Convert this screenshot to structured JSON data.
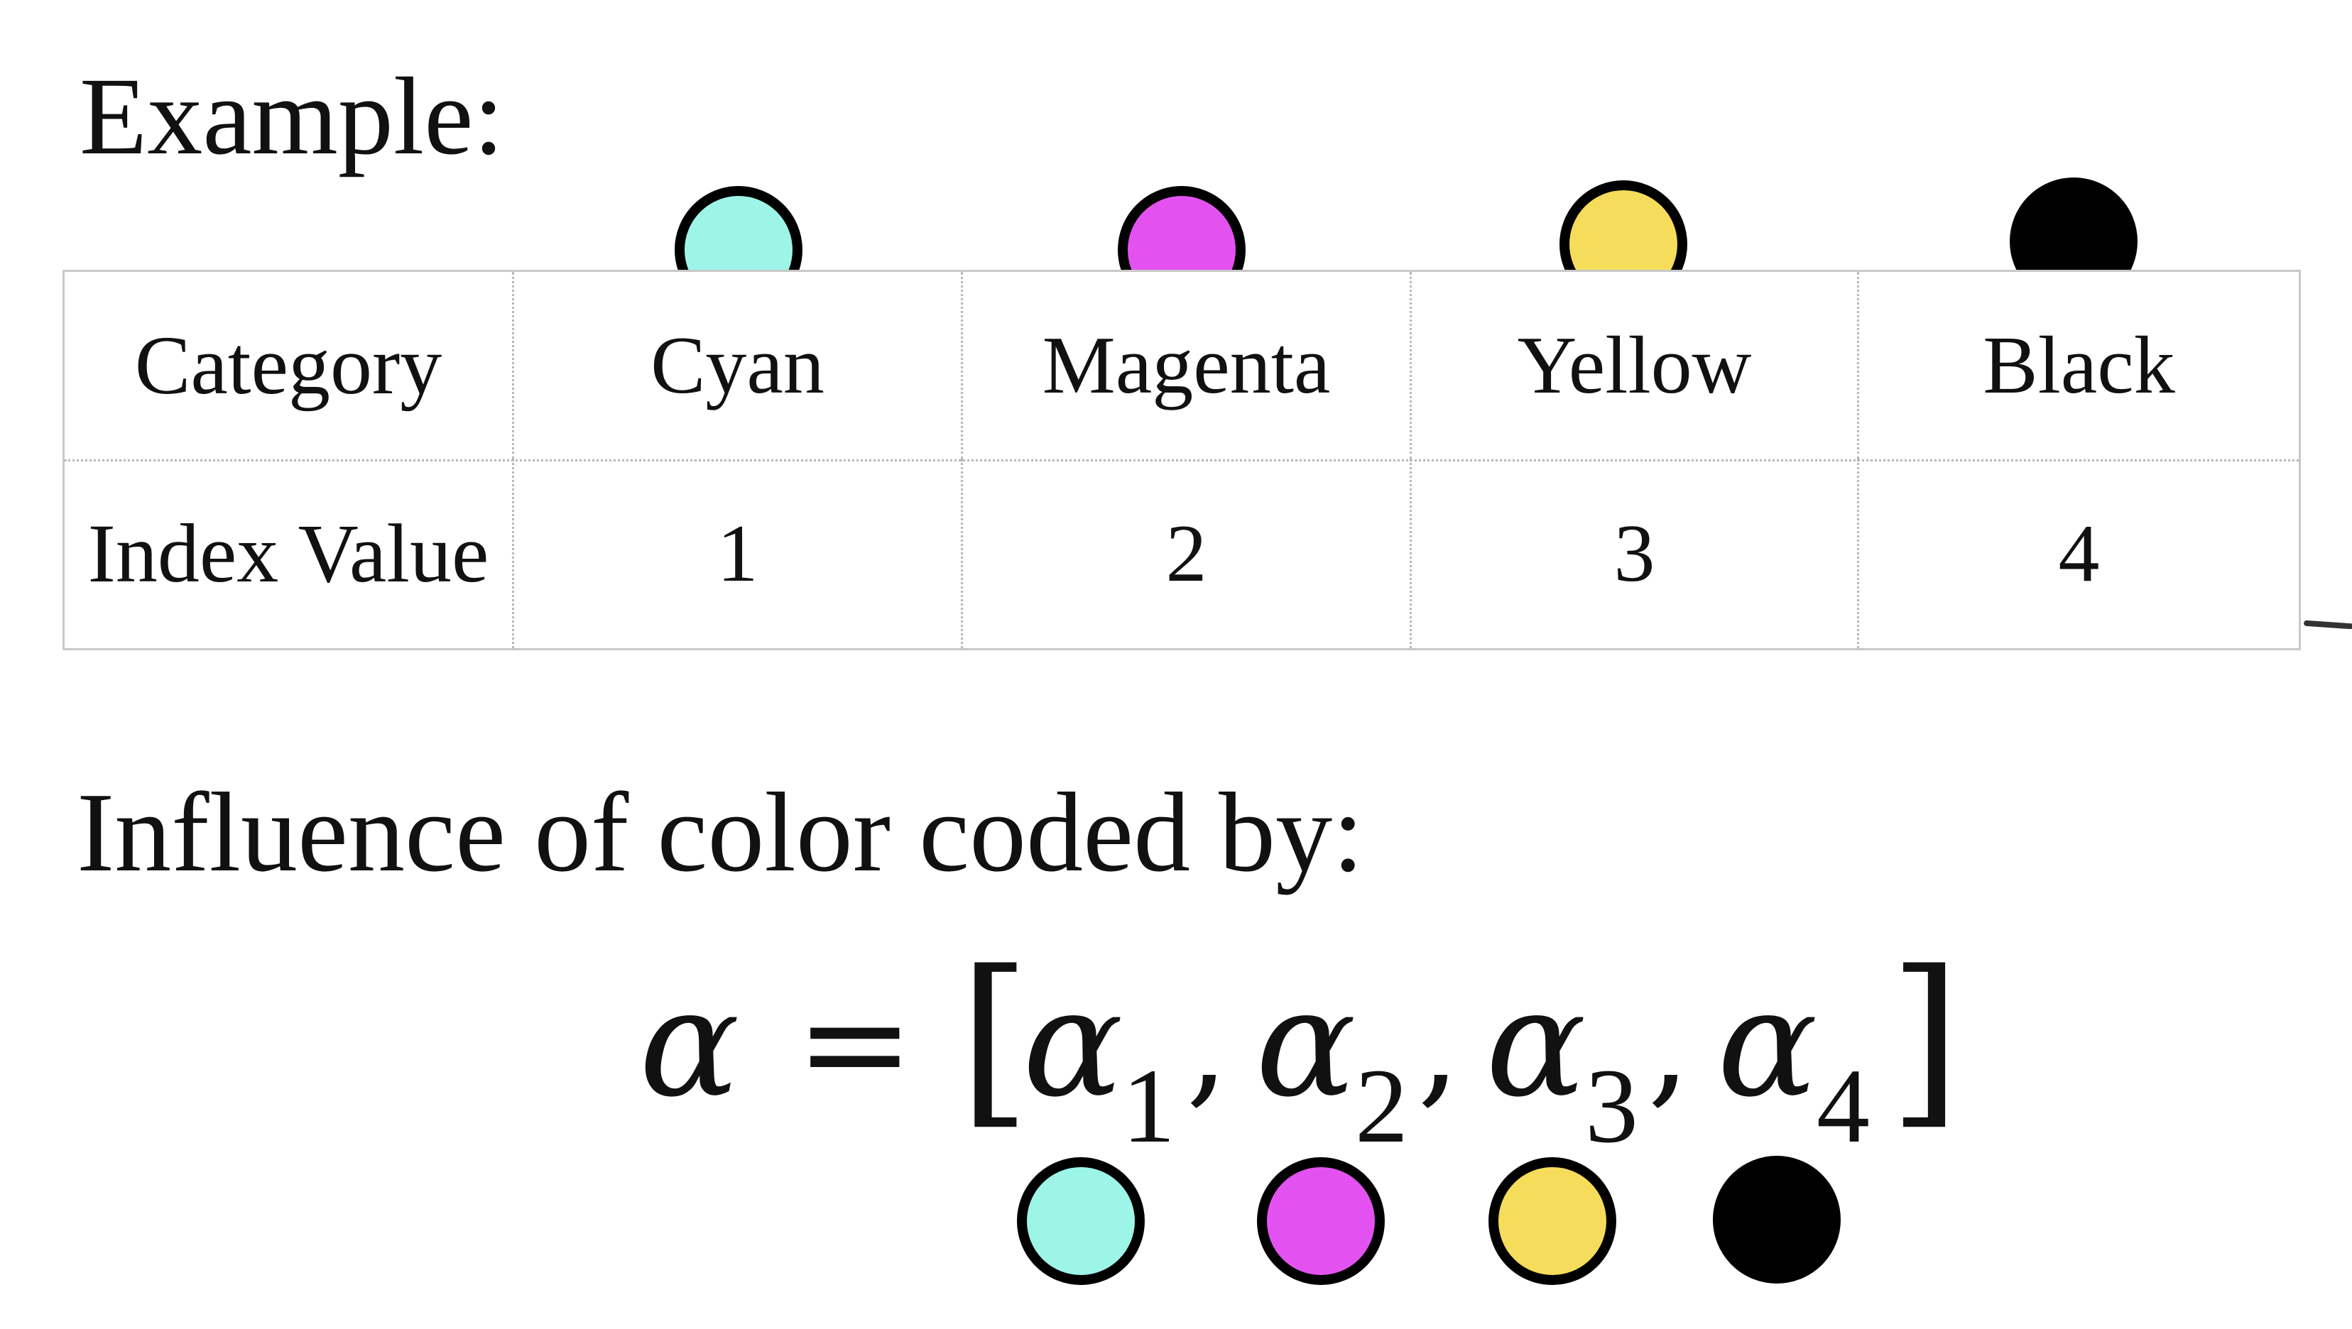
{
  "example": {
    "heading": "Example:"
  },
  "table": {
    "rows": [
      {
        "label": "Category",
        "cells": [
          "Cyan",
          "Magenta",
          "Yellow",
          "Black"
        ]
      },
      {
        "label": "Index Value",
        "cells": [
          "1",
          "2",
          "3",
          "4"
        ]
      }
    ],
    "swatch_colors": [
      "#9df5e8",
      "#e352f0",
      "#f5dc5a",
      "#000000"
    ]
  },
  "influence": {
    "heading": "Influence of color coded by:"
  },
  "formula": {
    "lhs": "α",
    "equals": "=",
    "open_bracket": "[",
    "close_bracket": "]",
    "symbol": "α",
    "subscripts": [
      "1",
      "2",
      "3",
      "4"
    ],
    "separator": ","
  }
}
